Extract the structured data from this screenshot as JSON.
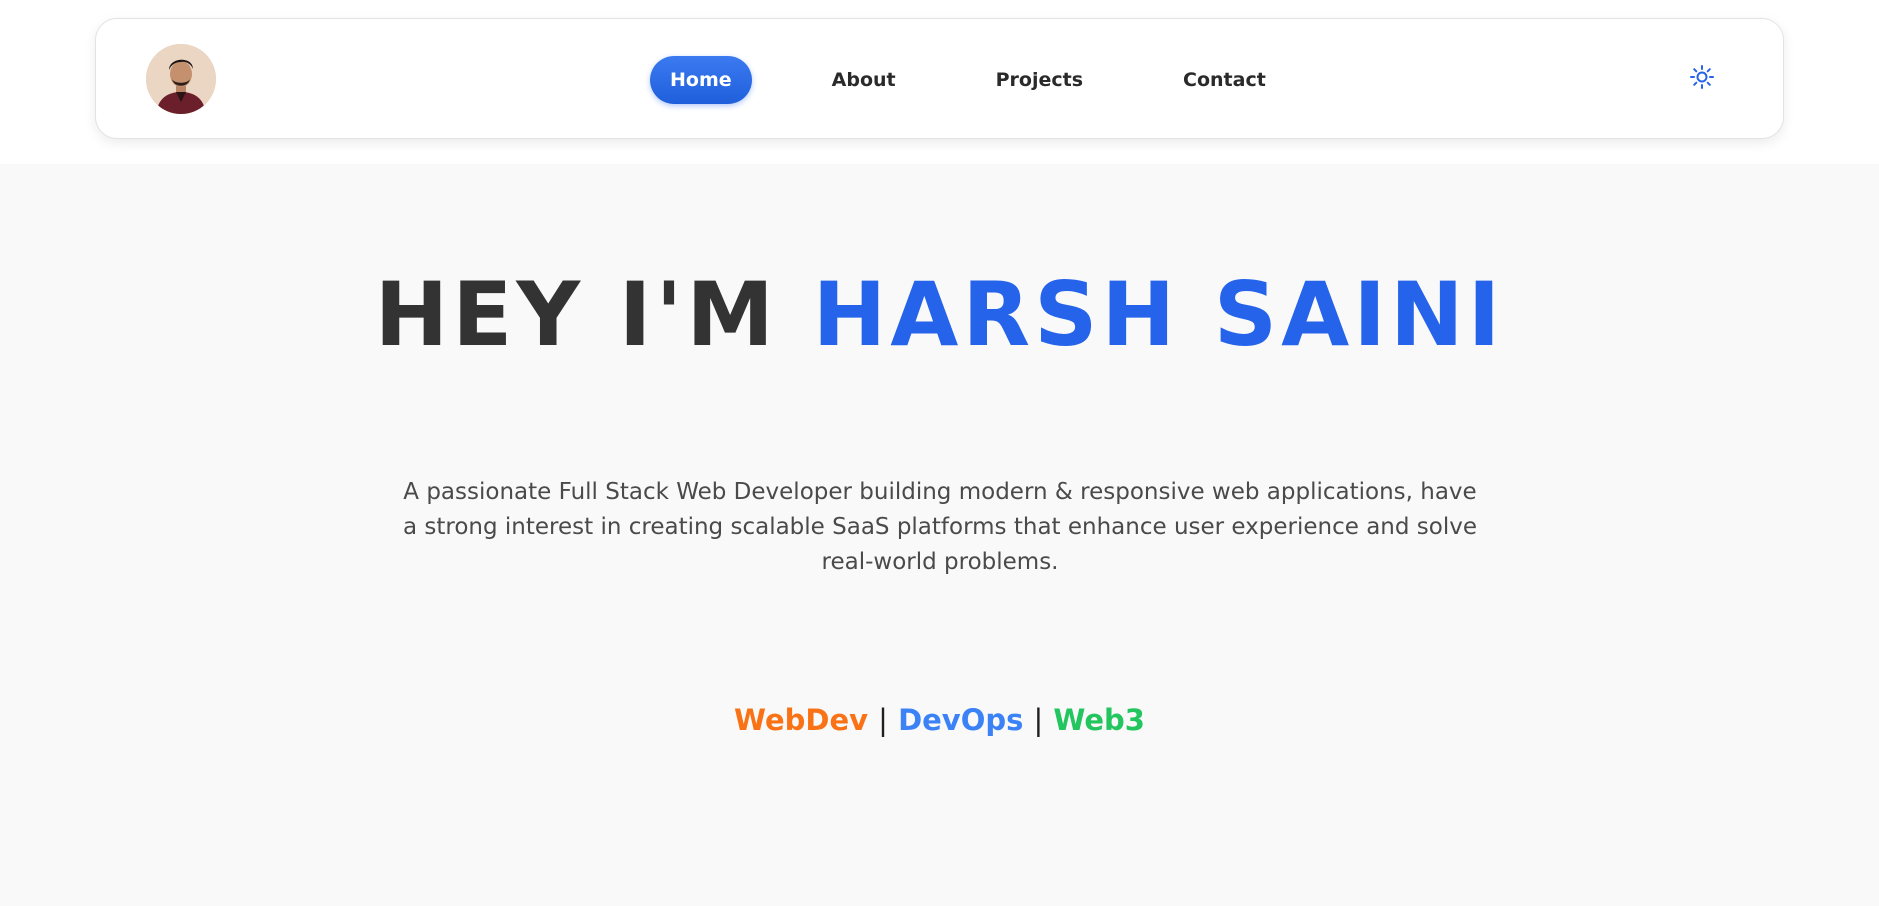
{
  "nav": {
    "avatar_alt": "",
    "links": [
      {
        "label": "Home",
        "active": true
      },
      {
        "label": "About",
        "active": false
      },
      {
        "label": "Projects",
        "active": false
      },
      {
        "label": "Contact",
        "active": false
      }
    ],
    "theme_icon": "sun-icon"
  },
  "hero": {
    "title_prefix": "HEY I'M",
    "title_name": "HARSH SAINI",
    "description": "A passionate Full Stack Web Developer building modern & responsive web applications, have a strong interest in creating scalable SaaS platforms that enhance user experience and solve real-world problems.",
    "skills": [
      {
        "label": "WebDev",
        "color": "#f97316"
      },
      {
        "label": "DevOps",
        "color": "#3b82f6"
      },
      {
        "label": "Web3",
        "color": "#22c55e"
      }
    ],
    "separator": "|"
  },
  "colors": {
    "accent": "#2563eb",
    "heading": "#333333",
    "body_text": "#4a4a4a",
    "hero_background": "#f9f9f9"
  }
}
